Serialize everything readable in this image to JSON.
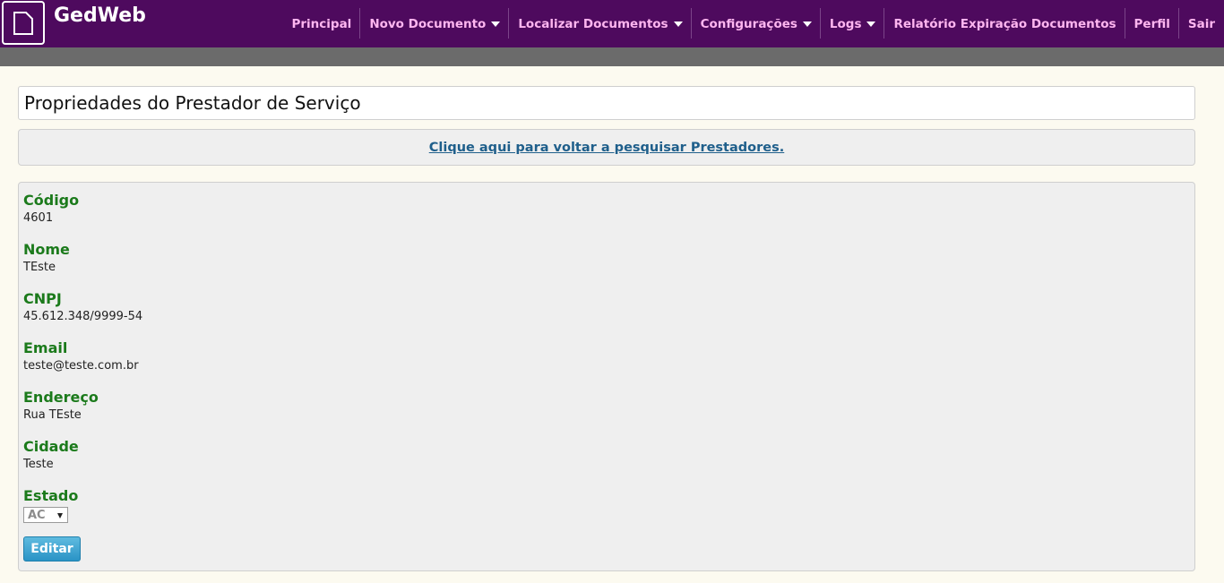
{
  "app": {
    "brand": "GedWeb"
  },
  "nav": [
    {
      "label": "Principal",
      "dropdown": false
    },
    {
      "label": "Novo Documento",
      "dropdown": true
    },
    {
      "label": "Localizar Documentos",
      "dropdown": true
    },
    {
      "label": "Configurações",
      "dropdown": true
    },
    {
      "label": "Logs",
      "dropdown": true
    },
    {
      "label": "Relatório Expiração Documentos",
      "dropdown": false
    },
    {
      "label": "Perfil",
      "dropdown": false
    },
    {
      "label": "Sair",
      "dropdown": false
    }
  ],
  "page": {
    "title": "Propriedades do Prestador de Serviço",
    "back_link": "Clique aqui para voltar a pesquisar Prestadores."
  },
  "fields": {
    "codigo": {
      "label": "Código",
      "value": "4601"
    },
    "nome": {
      "label": "Nome",
      "value": "TEste"
    },
    "cnpj": {
      "label": "CNPJ",
      "value": "45.612.348/9999-54"
    },
    "email": {
      "label": "Email",
      "value": "teste@teste.com.br"
    },
    "endereco": {
      "label": "Endereço",
      "value": "Rua TEste"
    },
    "cidade": {
      "label": "Cidade",
      "value": "Teste"
    },
    "estado": {
      "label": "Estado",
      "value": "AC"
    }
  },
  "actions": {
    "edit_label": "Editar"
  },
  "colors": {
    "topbar": "#4e0a5e",
    "nav_text": "#ffb6f0",
    "label_green": "#1b7a1b",
    "link_blue": "#1f5f8b",
    "button_blue": "#2a93c6"
  }
}
